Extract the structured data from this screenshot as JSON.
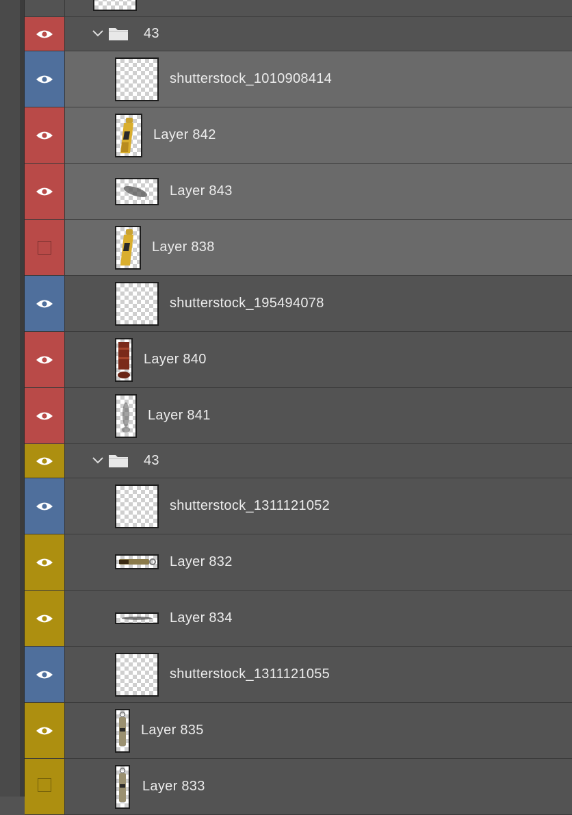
{
  "layers": {
    "group_1": {
      "name": "43",
      "color": "#b94a48"
    },
    "group_2": {
      "name": "43",
      "color": "#ad8f10"
    },
    "items": [
      {
        "name": "shutterstock_1010908414",
        "visible": true,
        "color": "blue"
      },
      {
        "name": "Layer 842",
        "visible": true,
        "color": "red"
      },
      {
        "name": "Layer 843",
        "visible": true,
        "color": "red"
      },
      {
        "name": "Layer 838",
        "visible": false,
        "color": "red"
      },
      {
        "name": "shutterstock_195494078",
        "visible": true,
        "color": "blue"
      },
      {
        "name": "Layer 840",
        "visible": true,
        "color": "red"
      },
      {
        "name": "Layer 841",
        "visible": true,
        "color": "red"
      },
      {
        "name": "shutterstock_1311121052",
        "visible": true,
        "color": "blue"
      },
      {
        "name": "Layer 832",
        "visible": true,
        "color": "yellow"
      },
      {
        "name": "Layer 834",
        "visible": true,
        "color": "yellow"
      },
      {
        "name": "shutterstock_1311121055",
        "visible": true,
        "color": "blue"
      },
      {
        "name": "Layer 835",
        "visible": true,
        "color": "yellow"
      },
      {
        "name": "Layer 833",
        "visible": false,
        "color": "yellow"
      }
    ]
  },
  "colors": {
    "red": "#b94a48",
    "blue": "#4f6f9c",
    "yellow": "#ad8f10",
    "panel": "#535353",
    "selected": "#6a6a6a"
  }
}
